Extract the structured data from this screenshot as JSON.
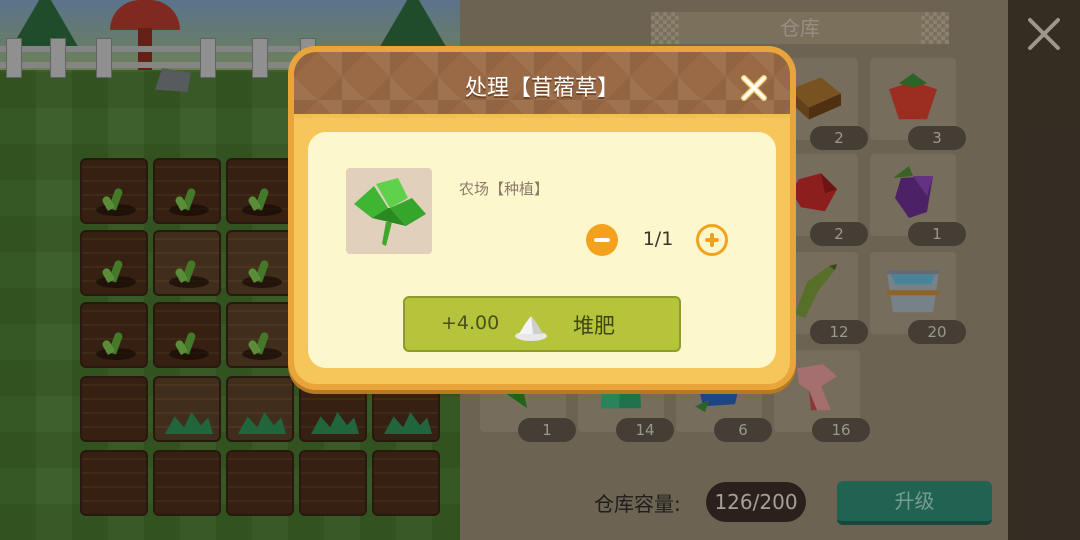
{
  "warehouse": {
    "title": "仓库",
    "capacity_label": "仓库容量:",
    "capacity_value": "126/200",
    "upgrade_label": "升级",
    "items": [
      {
        "name": "wood",
        "count": "2"
      },
      {
        "name": "strawberry",
        "count": "3"
      },
      {
        "name": "red-fruit",
        "count": "2"
      },
      {
        "name": "grape",
        "count": "1"
      },
      {
        "name": "banana",
        "count": "12"
      },
      {
        "name": "water-bucket",
        "count": "20"
      },
      {
        "name": "alfalfa",
        "count": "1"
      },
      {
        "name": "green-block",
        "count": "14"
      },
      {
        "name": "blue-flower",
        "count": "6"
      },
      {
        "name": "pink-ribbon",
        "count": "16"
      }
    ]
  },
  "dialog": {
    "title": "处理【苜蓿草】",
    "source_label": "农场【种植】",
    "quantity": "1/1",
    "compost_amount": "+4.00",
    "compost_label": "堆肥"
  },
  "colors": {
    "dialog_frame": "#e9a53c",
    "dialog_header": "#9a6a47",
    "dialog_body": "#fdf7cc",
    "compost_button": "#b5c43a",
    "upgrade_button": "#2d8a74",
    "qty_accent": "#f4a21e"
  },
  "icons": [
    "close-icon",
    "dialog-close-icon",
    "clover-icon",
    "compost-icon",
    "minus-icon",
    "plus-icon"
  ]
}
